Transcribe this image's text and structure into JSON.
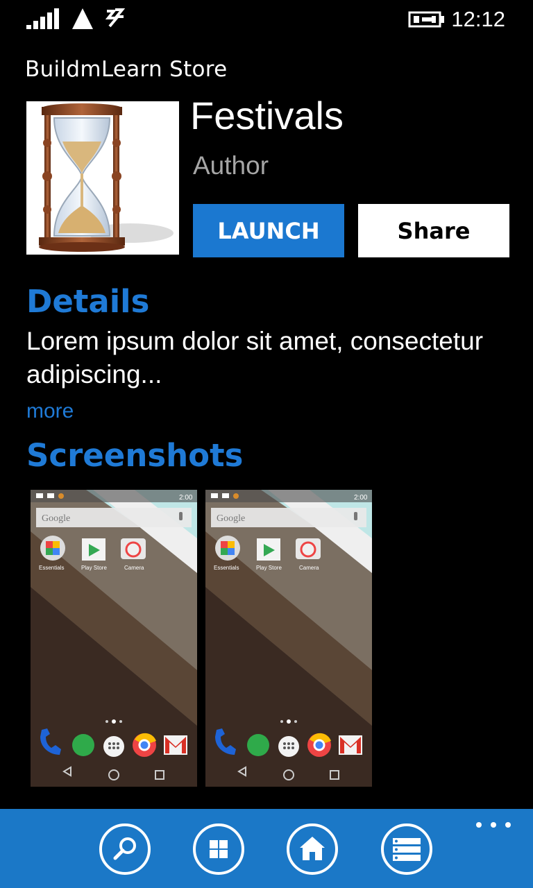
{
  "status_bar": {
    "time": "12:12",
    "icons": [
      "signal-strength-icon",
      "data-connection-icon",
      "wifi-icon",
      "battery-charging-icon"
    ]
  },
  "header": {
    "app_title": "BuildmLearn Store"
  },
  "app": {
    "name": "Festivals",
    "author": "Author",
    "icon": "hourglass-icon"
  },
  "actions": {
    "launch_label": "LAUNCH",
    "share_label": "Share"
  },
  "details": {
    "heading": "Details",
    "text": "Lorem ipsum dolor sit amet, consectetur adipiscing...",
    "more_label": "more"
  },
  "screenshots": {
    "heading": "Screenshots",
    "items": [
      {
        "status_time": "2:00",
        "search_text": "Google",
        "apps": [
          "Essentials",
          "Play Store",
          "Camera"
        ]
      },
      {
        "status_time": "2:00",
        "search_text": "Google",
        "apps": [
          "Essentials",
          "Play Store",
          "Camera"
        ]
      }
    ]
  },
  "app_bar": {
    "buttons": [
      "search-icon",
      "apps-grid-icon",
      "home-icon",
      "list-icon"
    ],
    "more_icon": "more-ellipsis-icon"
  },
  "colors": {
    "accent": "#1f7ad6",
    "launch_button": "#1b78d0",
    "app_bar": "#1b78c7",
    "background": "#000000",
    "author_text": "#a6a6a6"
  }
}
